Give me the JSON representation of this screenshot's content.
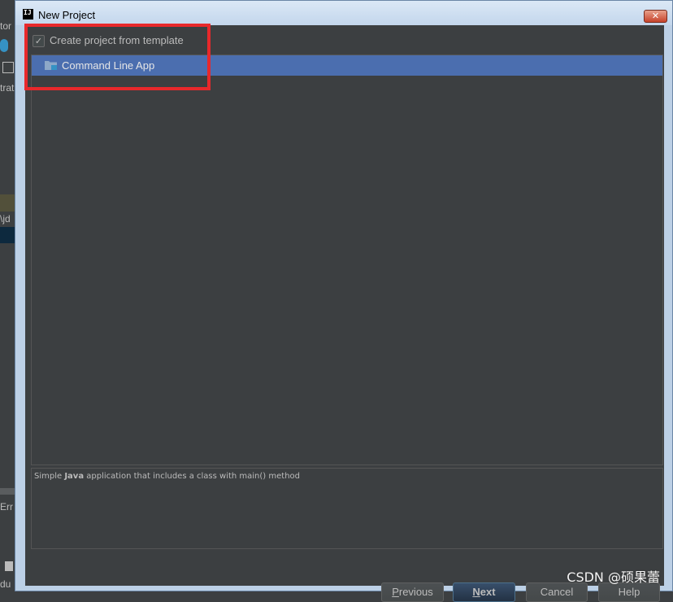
{
  "background_ide": {
    "fragments": [
      "tor",
      "trat",
      "\\jd",
      "Err",
      "du"
    ]
  },
  "dialog": {
    "title": "New Project",
    "app_icon_text": "IJ",
    "close_glyph": "✕"
  },
  "template_checkbox": {
    "label": "Create project from template",
    "checked": true,
    "check_glyph": "✓"
  },
  "templates": {
    "selected_index": 0,
    "items": [
      {
        "label": "Command Line App",
        "icon": "folder-icon"
      }
    ]
  },
  "description": {
    "prefix": "Simple ",
    "emphasis": "Java",
    "suffix": " application that includes a class with main() method"
  },
  "buttons": {
    "previous": {
      "mnemonic": "P",
      "rest": "revious"
    },
    "next": {
      "mnemonic": "N",
      "rest": "ext"
    },
    "cancel": {
      "label": "Cancel"
    },
    "help": {
      "label": "Help"
    }
  },
  "watermark": "CSDN @硕果蕾",
  "colors": {
    "selection": "#4b6eaf",
    "annotation": "#e8282b",
    "panel": "#3c3f41"
  }
}
